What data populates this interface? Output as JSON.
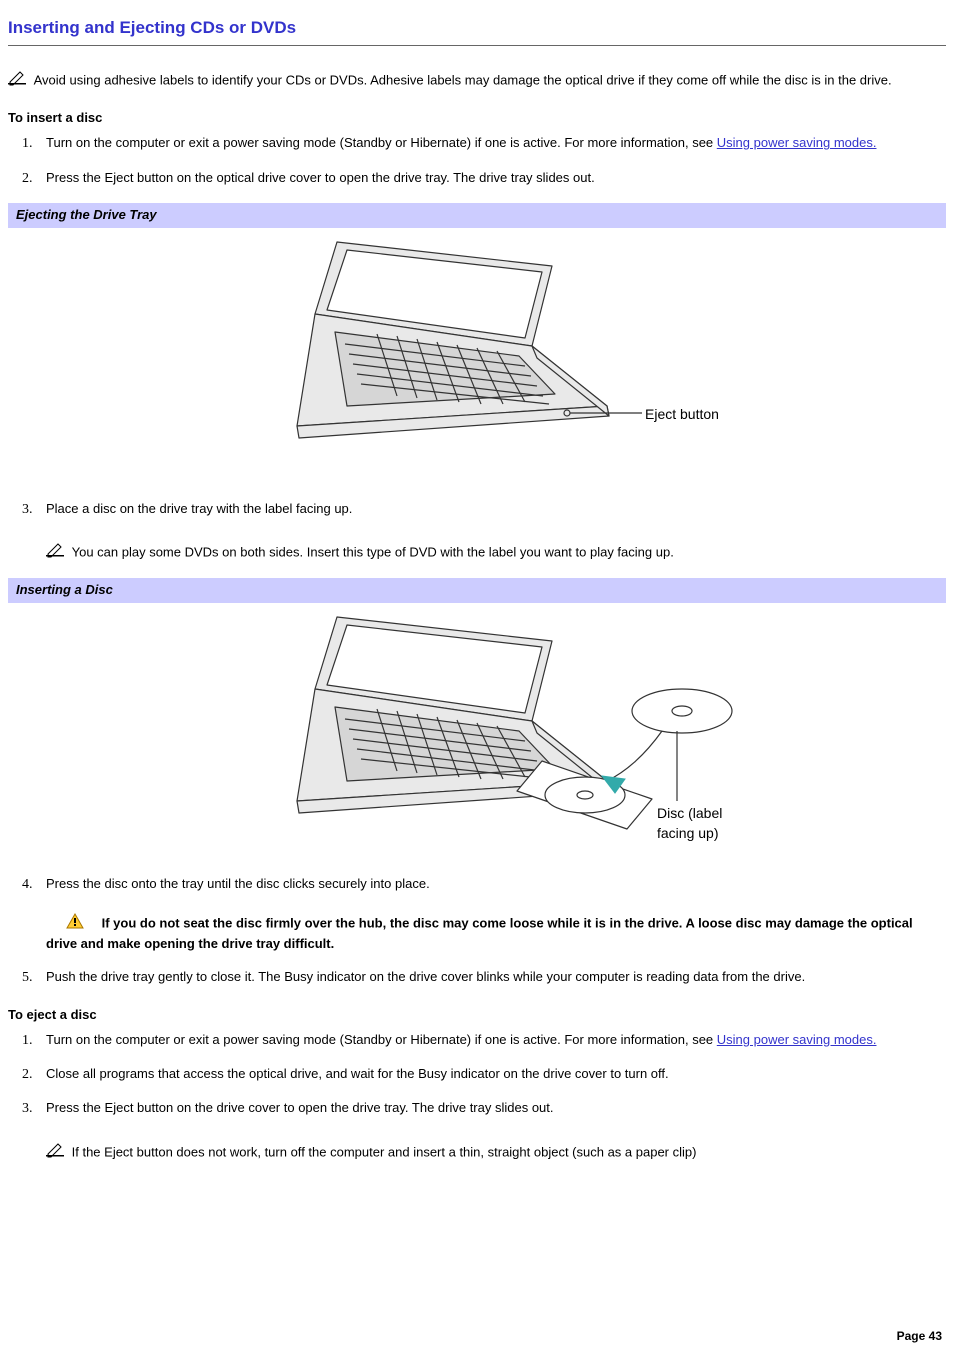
{
  "title": "Inserting and Ejecting CDs or DVDs",
  "top_note": "Avoid using adhesive labels to identify your CDs or DVDs. Adhesive labels may damage the optical drive if they come off while the disc is in the drive.",
  "insert_heading": "To insert a disc",
  "insert_steps": {
    "s1_a": "Turn on the computer or exit a power saving mode (Standby or Hibernate) if one is active. For more information, see ",
    "s1_link": "Using power saving modes.",
    "s2": "Press the Eject button on the optical drive cover to open the drive tray. The drive tray slides out.",
    "s3": "Place a disc on the drive tray with the label facing up.",
    "s3_note": "You can play some DVDs on both sides. Insert this type of DVD with the label you want to play facing up.",
    "s4": "Press the disc onto the tray until the disc clicks securely into place.",
    "s4_warn": "If you do not seat the disc firmly over the hub, the disc may come loose while it is in the drive. A loose disc may damage the optical drive and make opening the drive tray difficult.",
    "s5": "Push the drive tray gently to close it. The Busy indicator on the drive cover blinks while your computer is reading data from the drive."
  },
  "caption1": "Ejecting the Drive Tray",
  "caption2": "Inserting a Disc",
  "fig1_label": "Eject button",
  "fig2_label_line1": "Disc (label",
  "fig2_label_line2": "facing up)",
  "eject_heading": "To eject a disc",
  "eject_steps": {
    "s1_a": "Turn on the computer or exit a power saving mode (Standby or Hibernate) if one is active. For more information, see ",
    "s1_link": "Using power saving modes.",
    "s2": "Close all programs that access the optical drive, and wait for the Busy indicator on the drive cover to turn off.",
    "s3": "Press the Eject button on the drive cover to open the drive tray. The drive tray slides out.",
    "s3_note": "If the Eject button does not work, turn off the computer and insert a thin, straight object (such as a paper clip)"
  },
  "page_number": "Page 43"
}
